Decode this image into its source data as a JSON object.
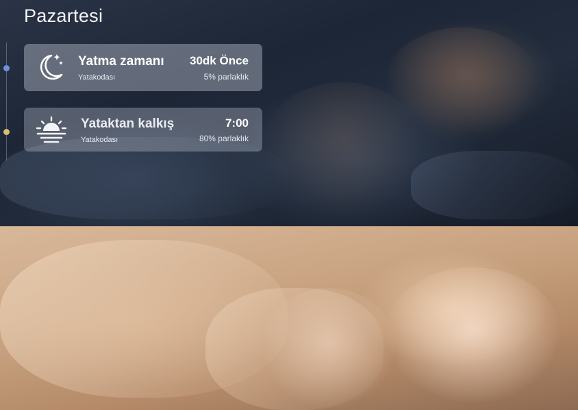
{
  "header": {
    "day": "Pazartesi"
  },
  "timeline": {
    "colors": {
      "bedtime_dot": "#6f8fe0",
      "wakeup_dot": "#d8c070"
    }
  },
  "schedule": [
    {
      "title": "Yatma zamanı",
      "room": "Yatakodası",
      "time": "30dk Önce",
      "brightness": "5% parlaklık",
      "icon": "moon-stars-icon"
    },
    {
      "title": "Yataktan kalkış",
      "room": "Yatakodası",
      "time": "7:00",
      "brightness": "80% parlaklık",
      "icon": "sunrise-icon"
    }
  ]
}
